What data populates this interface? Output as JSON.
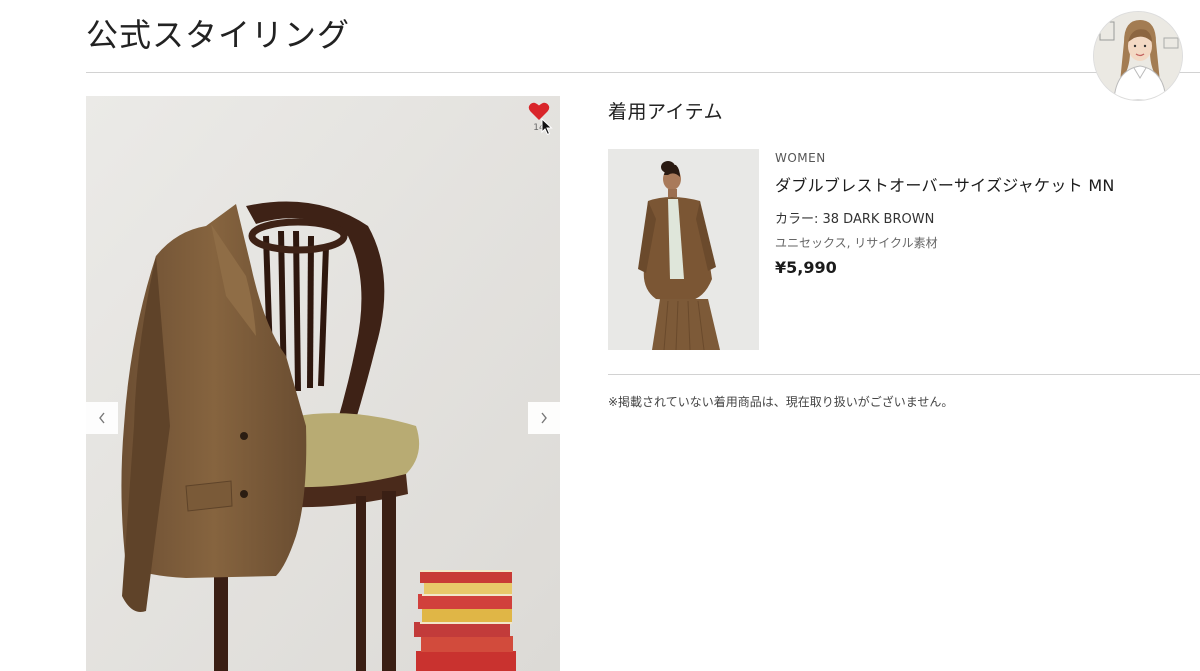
{
  "header": {
    "title": "公式スタイリング"
  },
  "styling_image": {
    "favorite_count": "14",
    "prev_icon": "chevron-left-icon",
    "next_icon": "chevron-right-icon"
  },
  "worn_items": {
    "section_title": "着用アイテム",
    "items": [
      {
        "category": "WOMEN",
        "name": "ダブルブレストオーバーサイズジャケット MN",
        "color": "カラー: 38 DARK BROWN",
        "tags": "ユニセックス, リサイクル素材",
        "price": "¥5,990"
      }
    ],
    "note": "※掲載されていない着用商品は、現在取り扱いがございません。"
  },
  "colors": {
    "favorite_heart": "#d9252a",
    "jacket_brown": "#7a5a3a",
    "rule": "#d2d2d2"
  }
}
